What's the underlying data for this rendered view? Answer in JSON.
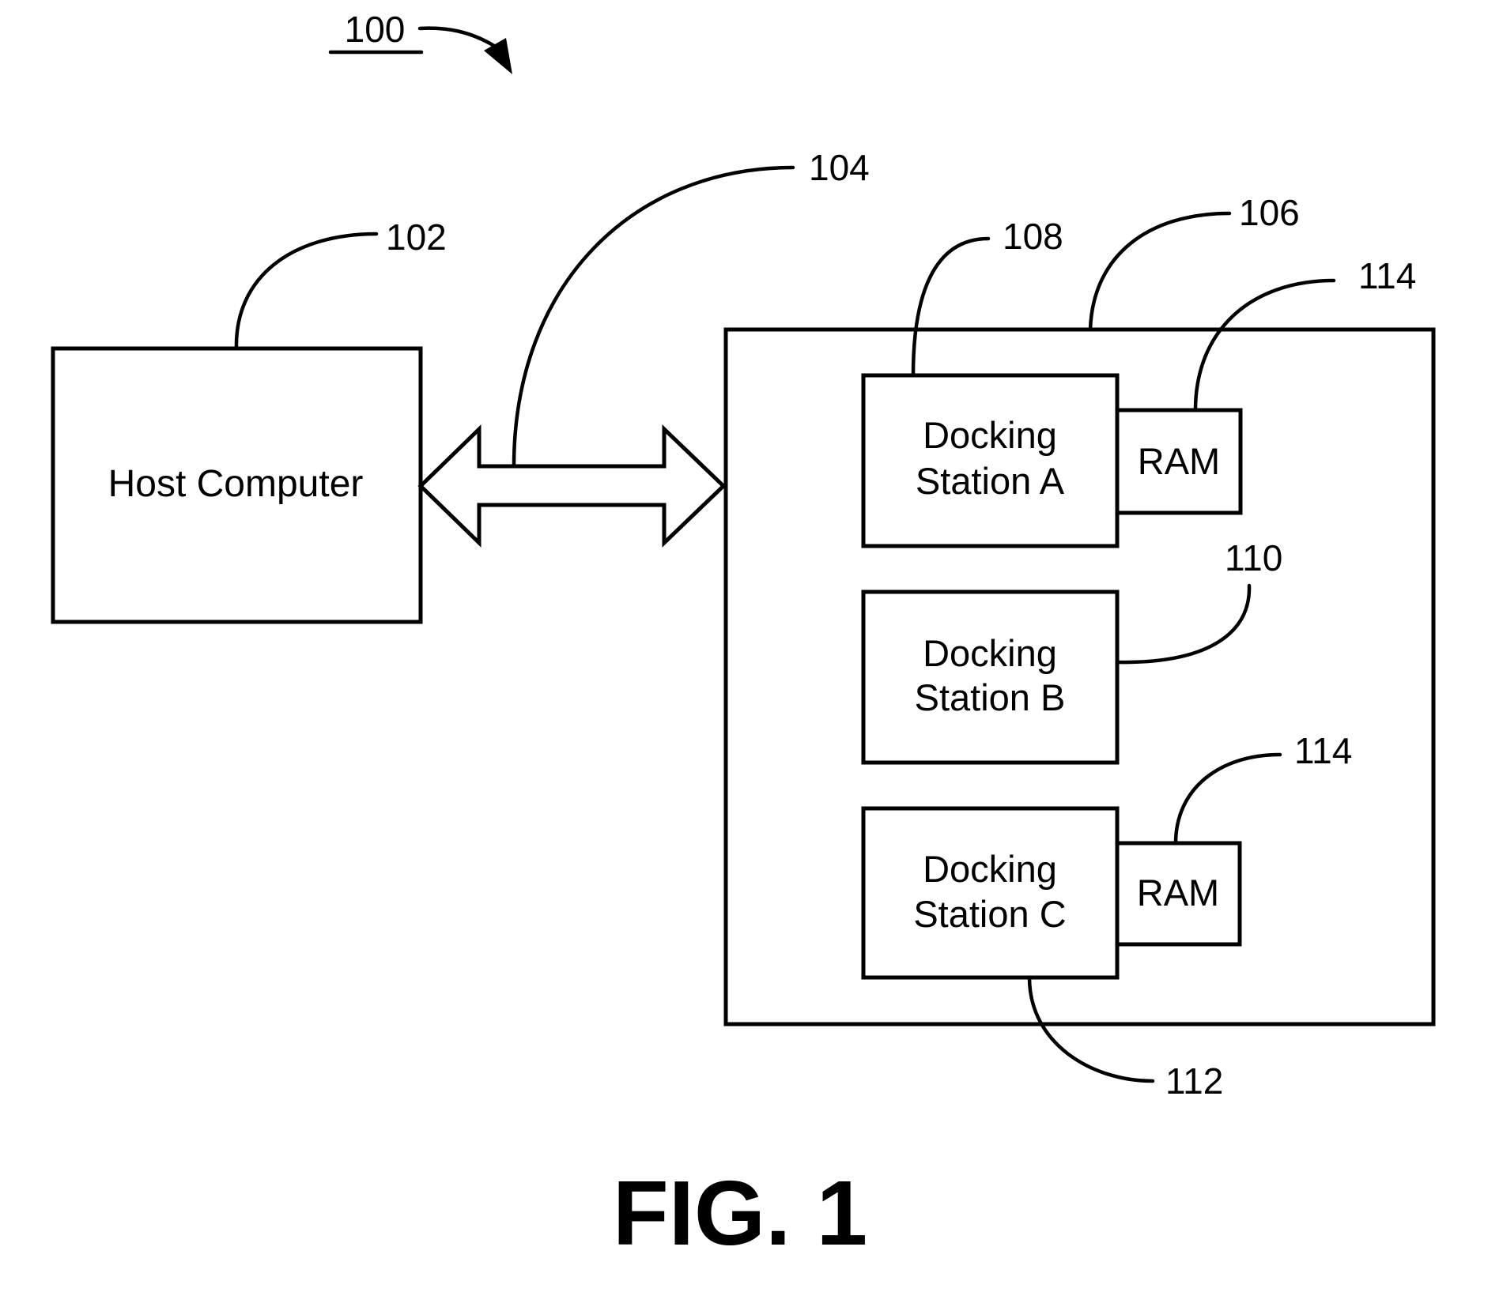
{
  "figure": {
    "reference": "100",
    "caption": "FIG. 1"
  },
  "colors": {
    "ink": "#000000",
    "paper": "#ffffff"
  },
  "components": {
    "host": {
      "ref": "102",
      "label": "Host Computer"
    },
    "link": {
      "ref": "104"
    },
    "enclosure": {
      "ref": "106"
    },
    "dock_a": {
      "ref": "108",
      "line1": "Docking",
      "line2": "Station A"
    },
    "dock_b": {
      "ref": "110",
      "line1": "Docking",
      "line2": "Station B"
    },
    "dock_c": {
      "ref": "112",
      "line1": "Docking",
      "line2": "Station C"
    },
    "ram_a": {
      "ref": "114",
      "label": "RAM"
    },
    "ram_c": {
      "ref": "114",
      "label": "RAM"
    }
  }
}
